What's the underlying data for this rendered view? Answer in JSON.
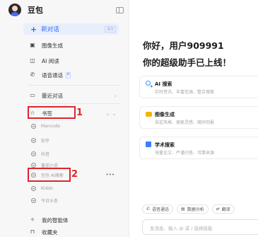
{
  "sidebar": {
    "app_name": "豆包",
    "new_chat": {
      "label": "新对话",
      "shortcut": "⌘K"
    },
    "items": [
      {
        "label": "图像生成"
      },
      {
        "label": "AI 阅读"
      },
      {
        "label": "语音通话",
        "badge": "P"
      },
      {
        "label": "最近对话"
      },
      {
        "label": "书签"
      }
    ],
    "bookmarks": [
      {
        "label": "Mancode"
      },
      {
        "label": "知乎"
      },
      {
        "label": "抖音"
      },
      {
        "label": "番茄小说"
      },
      {
        "label": "豆包 AI搜索"
      },
      {
        "label": "Kiddo"
      },
      {
        "label": "今日头条"
      }
    ],
    "bottom": [
      {
        "label": "我的智能体"
      },
      {
        "label": "收藏夹"
      }
    ],
    "annotations": {
      "marker1": "1",
      "marker2": "2"
    }
  },
  "main": {
    "greeting_line1": "你好，用户909991",
    "greeting_line2": "你的超级助手已上线！",
    "cards": [
      {
        "title": "AI 搜索",
        "desc": "实时资讯、丰富信源、整合搜索",
        "icon": "search-icon",
        "color": "#2f9bff"
      },
      {
        "title": "图像生成",
        "desc": "自定风格、搜索灵感、随时回报",
        "icon": "image-icon",
        "color": "#f5b400"
      },
      {
        "title": "学术搜索",
        "desc": "海量论文、严谨问答、可靠来源",
        "icon": "book-icon",
        "color": "#3f7cff"
      }
    ],
    "toolbar": [
      {
        "label": "语音通话",
        "icon": "phone-icon"
      },
      {
        "label": "数据分析",
        "icon": "chart-icon"
      },
      {
        "label": "翻译",
        "icon": "translate-icon"
      }
    ],
    "input_placeholder": "发消息、输入 @ 或 / 选择技能"
  }
}
